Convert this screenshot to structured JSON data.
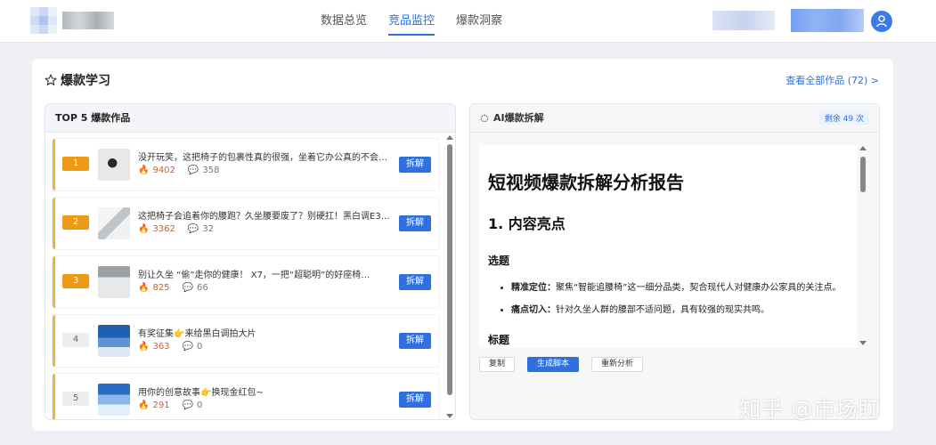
{
  "nav": {
    "items": [
      {
        "label": "数据总览",
        "active": false
      },
      {
        "label": "竞品监控",
        "active": true
      },
      {
        "label": "爆款洞察",
        "active": false
      }
    ]
  },
  "section": {
    "title": "爆款学习",
    "view_all": "查看全部作品 (72) >"
  },
  "top5": {
    "header": "TOP 5 爆款作品",
    "action_label": "拆解",
    "items": [
      {
        "rank": "1",
        "title": "没开玩笑，这把椅子的包裹性真的很强，坐着它办公真的不会累…",
        "hot": "9402",
        "comments": "358"
      },
      {
        "rank": "2",
        "title": "这把椅子会追着你的腰跑？久坐腰要废了？别硬扛！黑白调E3…",
        "hot": "3362",
        "comments": "32"
      },
      {
        "rank": "3",
        "title": "别让久坐 “偷”走你的健康！      X7，一把“超聪明”的好座椅…",
        "hot": "825",
        "comments": "66"
      },
      {
        "rank": "4",
        "title": "有奖征集👉来给黑白调拍大片",
        "hot": "363",
        "comments": "0"
      },
      {
        "rank": "5",
        "title": "用你的创意故事👉换现金红包~",
        "hot": "291",
        "comments": "0"
      }
    ]
  },
  "ai": {
    "header": "AI爆款拆解",
    "remaining": "剩余 49 次",
    "report": {
      "h1": "短视频爆款拆解分析报告",
      "h2": "1. 内容亮点",
      "h3_topic": "选题",
      "points": [
        {
          "label": "精准定位：",
          "text": "聚焦“智能追腰椅”这一细分品类，契合现代人对健康办公家具的关注点。"
        },
        {
          "label": "痛点切入：",
          "text": "针对久坐人群的腰部不适问题，具有较强的现实共鸣。"
        }
      ],
      "h3_title": "标题"
    },
    "actions": {
      "copy": "复制",
      "generate": "生成脚本",
      "reanalyze": "重新分析"
    }
  },
  "watermark": "知乎 @市场盯",
  "colors": {
    "accent": "#2f6fde",
    "rank_top": "#ef9a16",
    "item_border": "#f5b23a"
  }
}
